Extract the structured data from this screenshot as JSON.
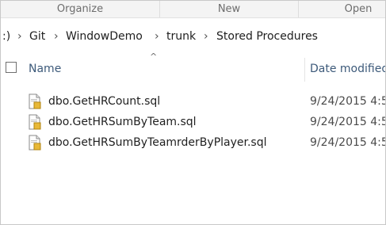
{
  "ribbon": {
    "groups": [
      "Organize",
      "New",
      "Open"
    ]
  },
  "address": {
    "leading": ":)",
    "crumbs": [
      "Git",
      "WindowDemo",
      "trunk",
      "Stored Procedures"
    ]
  },
  "columns": {
    "name": "Name",
    "date_modified": "Date modified"
  },
  "files": [
    {
      "name": "dbo.GetHRCount.sql",
      "date": "9/24/2015 4:5",
      "icon": "sql-file-icon"
    },
    {
      "name": "dbo.GetHRSumByTeam.sql",
      "date": "9/24/2015 4:5",
      "icon": "sql-file-icon"
    },
    {
      "name": "dbo.GetHRSumByTeamrderByPlayer.sql",
      "date": "9/24/2015 4:5",
      "icon": "sql-file-icon"
    }
  ],
  "colors": {
    "header_text": "#3d5a7a",
    "ribbon_bg": "#f4f4f4"
  }
}
